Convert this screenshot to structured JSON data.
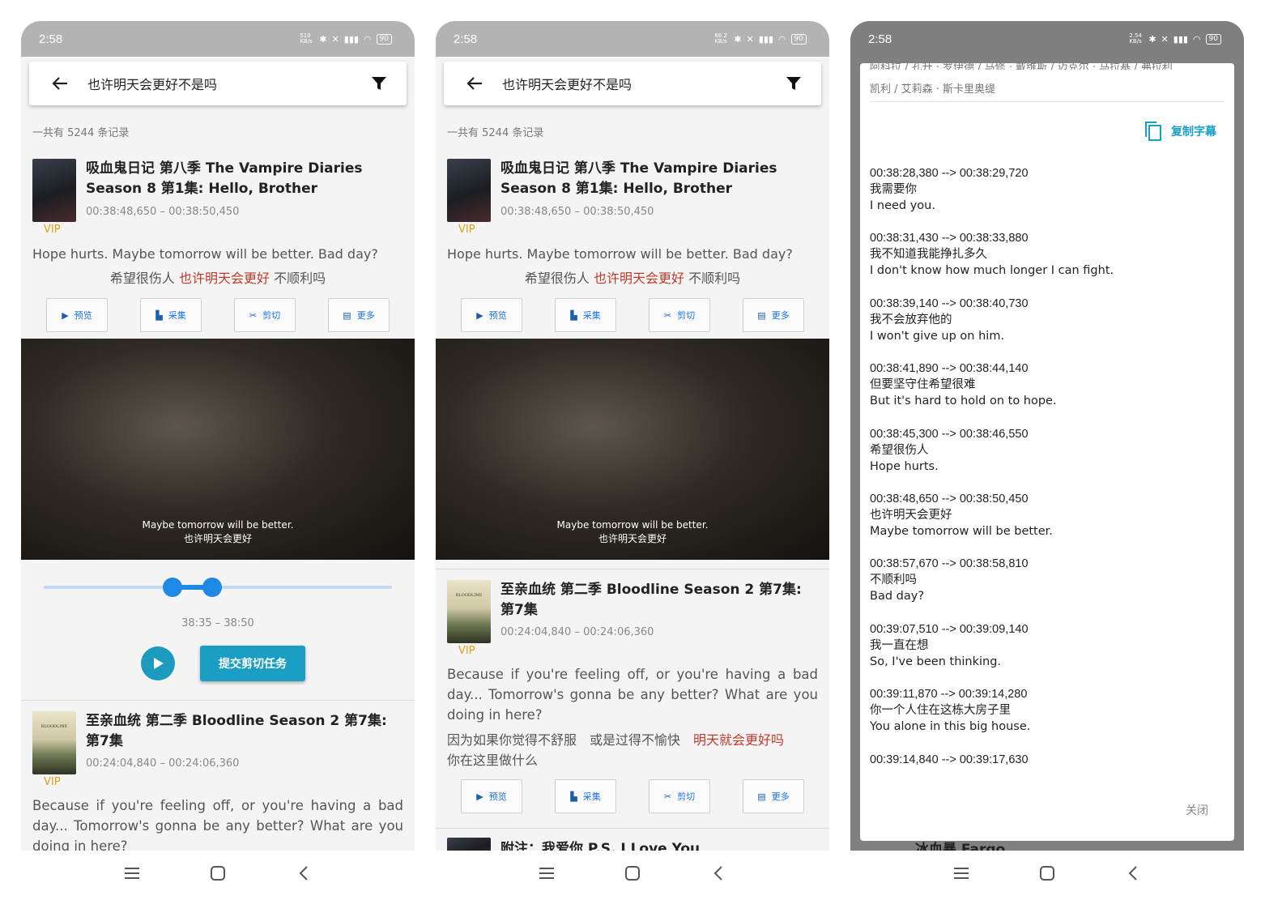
{
  "status": {
    "time": "2:58",
    "battery": "90",
    "speed1": "510 KB/s",
    "speed2": "66.2 KB/s",
    "speed3": "2.54 KB/s"
  },
  "search": {
    "query": "也许明天会更好不是吗"
  },
  "results": {
    "count_text": "一共有 5244 条记录"
  },
  "item1": {
    "title": "吸血鬼日记 第八季 The Vampire Diaries Season 8 第1集: Hello, Brother",
    "time_range": "00:38:48,650 – 00:38:50,450",
    "vip": "VIP",
    "en": "Hope hurts. Maybe tomorrow will be better. Bad day?",
    "zh_pre": "希望很伤人",
    "zh_hl": "也许明天会更好",
    "zh_post": "不顺利吗"
  },
  "item2": {
    "title": "至亲血统 第二季 Bloodline Season 2 第7集: 第7集",
    "time_range": "00:24:04,840 – 00:24:06,360",
    "vip": "VIP",
    "en": "Because if you're feeling off, or you're having a bad day... Tomorrow's gonna be any better? What are you doing in here?",
    "zh_pre": "因为如果你觉得不舒服　或是过得不愉快",
    "zh_hl": "明天就会更好吗",
    "zh_post": "你在这里做什么"
  },
  "item3": {
    "title": "附注：我爱你 P.S. I Love You"
  },
  "poster_text": {
    "bloodline": "BLOODLINE"
  },
  "actions": {
    "preview": "预览",
    "collect": "采集",
    "cut": "剪切",
    "more": "更多"
  },
  "player": {
    "sub_en": "Maybe tomorrow will be better.",
    "sub_zh": "也许明天会更好",
    "range": "38:35 – 38:50",
    "submit": "提交剪切任务"
  },
  "dialog": {
    "cast_line1": "阿科拉 / 孔升 · 罗伊德 / 马修 · 戴维斯 / 迈克尔 · 马拉基 / 弗拉利",
    "cast_line2": "凯利 / 艾莉森 · 斯卡里奥缇",
    "copy": "复制字幕",
    "close": "关闭",
    "cues": [
      {
        "tc": "00:38:28,380 --> 00:38:29,720",
        "zh": "我需要你",
        "en": "I need you."
      },
      {
        "tc": "00:38:31,430 --> 00:38:33,880",
        "zh": "我不知道我能挣扎多久",
        "en": "I don't know how much longer I can fight."
      },
      {
        "tc": "00:38:39,140 --> 00:38:40,730",
        "zh": "我不会放弃他的",
        "en": "I won't give up on him."
      },
      {
        "tc": "00:38:41,890 --> 00:38:44,140",
        "zh": "但要坚守住希望很难",
        "en": "But it's hard to hold on to hope."
      },
      {
        "tc": "00:38:45,300 --> 00:38:46,550",
        "zh": "希望很伤人",
        "en": "Hope hurts."
      },
      {
        "tc": "00:38:48,650 --> 00:38:50,450",
        "zh": "也许明天会更好",
        "en": "Maybe tomorrow will be better."
      },
      {
        "tc": "00:38:57,670 --> 00:38:58,810",
        "zh": "不顺利吗",
        "en": "Bad day?"
      },
      {
        "tc": "00:39:07,510 --> 00:39:09,140",
        "zh": "我一直在想",
        "en": "So, I've been thinking."
      },
      {
        "tc": "00:39:11,870 --> 00:39:14,280",
        "zh": "你一个人住在这栋大房子里",
        "en": "You alone in this big house."
      },
      {
        "tc": "00:39:14,840 --> 00:39:17,630",
        "zh": "",
        "en": ""
      }
    ],
    "under_text": "冰血暴 Fargo"
  },
  "colors": {
    "accent": "#1a9ec4",
    "highlight": "#c0392b",
    "vip": "#d8a31a"
  }
}
